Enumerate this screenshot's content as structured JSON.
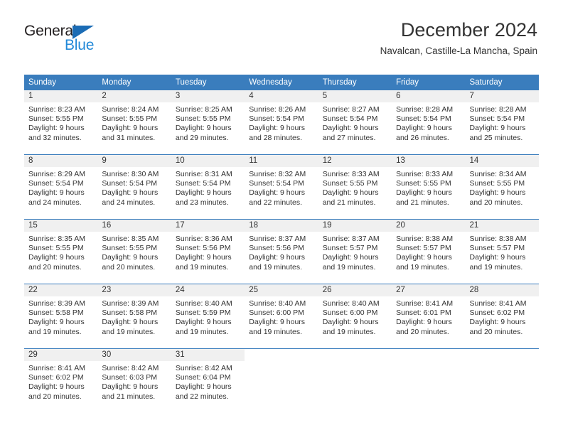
{
  "logo": {
    "text_top": "General",
    "text_bottom": "Blue",
    "triangle_color": "#1b6cb5",
    "blue_color": "#2389d8",
    "dark_color": "#231f20"
  },
  "header": {
    "title": "December 2024",
    "subtitle": "Navalcan, Castille-La Mancha, Spain"
  },
  "theme": {
    "header_row_bg": "#3a7dbd",
    "header_row_text": "#ffffff",
    "daynum_band_bg": "#f0f0f0",
    "body_text": "#333333"
  },
  "calendar": {
    "weekday_headers": [
      "Sunday",
      "Monday",
      "Tuesday",
      "Wednesday",
      "Thursday",
      "Friday",
      "Saturday"
    ],
    "weeks": [
      [
        {
          "day": "1",
          "sunrise": "Sunrise: 8:23 AM",
          "sunset": "Sunset: 5:55 PM",
          "daylight_line1": "Daylight: 9 hours",
          "daylight_line2": "and 32 minutes."
        },
        {
          "day": "2",
          "sunrise": "Sunrise: 8:24 AM",
          "sunset": "Sunset: 5:55 PM",
          "daylight_line1": "Daylight: 9 hours",
          "daylight_line2": "and 31 minutes."
        },
        {
          "day": "3",
          "sunrise": "Sunrise: 8:25 AM",
          "sunset": "Sunset: 5:55 PM",
          "daylight_line1": "Daylight: 9 hours",
          "daylight_line2": "and 29 minutes."
        },
        {
          "day": "4",
          "sunrise": "Sunrise: 8:26 AM",
          "sunset": "Sunset: 5:54 PM",
          "daylight_line1": "Daylight: 9 hours",
          "daylight_line2": "and 28 minutes."
        },
        {
          "day": "5",
          "sunrise": "Sunrise: 8:27 AM",
          "sunset": "Sunset: 5:54 PM",
          "daylight_line1": "Daylight: 9 hours",
          "daylight_line2": "and 27 minutes."
        },
        {
          "day": "6",
          "sunrise": "Sunrise: 8:28 AM",
          "sunset": "Sunset: 5:54 PM",
          "daylight_line1": "Daylight: 9 hours",
          "daylight_line2": "and 26 minutes."
        },
        {
          "day": "7",
          "sunrise": "Sunrise: 8:28 AM",
          "sunset": "Sunset: 5:54 PM",
          "daylight_line1": "Daylight: 9 hours",
          "daylight_line2": "and 25 minutes."
        }
      ],
      [
        {
          "day": "8",
          "sunrise": "Sunrise: 8:29 AM",
          "sunset": "Sunset: 5:54 PM",
          "daylight_line1": "Daylight: 9 hours",
          "daylight_line2": "and 24 minutes."
        },
        {
          "day": "9",
          "sunrise": "Sunrise: 8:30 AM",
          "sunset": "Sunset: 5:54 PM",
          "daylight_line1": "Daylight: 9 hours",
          "daylight_line2": "and 24 minutes."
        },
        {
          "day": "10",
          "sunrise": "Sunrise: 8:31 AM",
          "sunset": "Sunset: 5:54 PM",
          "daylight_line1": "Daylight: 9 hours",
          "daylight_line2": "and 23 minutes."
        },
        {
          "day": "11",
          "sunrise": "Sunrise: 8:32 AM",
          "sunset": "Sunset: 5:54 PM",
          "daylight_line1": "Daylight: 9 hours",
          "daylight_line2": "and 22 minutes."
        },
        {
          "day": "12",
          "sunrise": "Sunrise: 8:33 AM",
          "sunset": "Sunset: 5:55 PM",
          "daylight_line1": "Daylight: 9 hours",
          "daylight_line2": "and 21 minutes."
        },
        {
          "day": "13",
          "sunrise": "Sunrise: 8:33 AM",
          "sunset": "Sunset: 5:55 PM",
          "daylight_line1": "Daylight: 9 hours",
          "daylight_line2": "and 21 minutes."
        },
        {
          "day": "14",
          "sunrise": "Sunrise: 8:34 AM",
          "sunset": "Sunset: 5:55 PM",
          "daylight_line1": "Daylight: 9 hours",
          "daylight_line2": "and 20 minutes."
        }
      ],
      [
        {
          "day": "15",
          "sunrise": "Sunrise: 8:35 AM",
          "sunset": "Sunset: 5:55 PM",
          "daylight_line1": "Daylight: 9 hours",
          "daylight_line2": "and 20 minutes."
        },
        {
          "day": "16",
          "sunrise": "Sunrise: 8:35 AM",
          "sunset": "Sunset: 5:55 PM",
          "daylight_line1": "Daylight: 9 hours",
          "daylight_line2": "and 20 minutes."
        },
        {
          "day": "17",
          "sunrise": "Sunrise: 8:36 AM",
          "sunset": "Sunset: 5:56 PM",
          "daylight_line1": "Daylight: 9 hours",
          "daylight_line2": "and 19 minutes."
        },
        {
          "day": "18",
          "sunrise": "Sunrise: 8:37 AM",
          "sunset": "Sunset: 5:56 PM",
          "daylight_line1": "Daylight: 9 hours",
          "daylight_line2": "and 19 minutes."
        },
        {
          "day": "19",
          "sunrise": "Sunrise: 8:37 AM",
          "sunset": "Sunset: 5:57 PM",
          "daylight_line1": "Daylight: 9 hours",
          "daylight_line2": "and 19 minutes."
        },
        {
          "day": "20",
          "sunrise": "Sunrise: 8:38 AM",
          "sunset": "Sunset: 5:57 PM",
          "daylight_line1": "Daylight: 9 hours",
          "daylight_line2": "and 19 minutes."
        },
        {
          "day": "21",
          "sunrise": "Sunrise: 8:38 AM",
          "sunset": "Sunset: 5:57 PM",
          "daylight_line1": "Daylight: 9 hours",
          "daylight_line2": "and 19 minutes."
        }
      ],
      [
        {
          "day": "22",
          "sunrise": "Sunrise: 8:39 AM",
          "sunset": "Sunset: 5:58 PM",
          "daylight_line1": "Daylight: 9 hours",
          "daylight_line2": "and 19 minutes."
        },
        {
          "day": "23",
          "sunrise": "Sunrise: 8:39 AM",
          "sunset": "Sunset: 5:58 PM",
          "daylight_line1": "Daylight: 9 hours",
          "daylight_line2": "and 19 minutes."
        },
        {
          "day": "24",
          "sunrise": "Sunrise: 8:40 AM",
          "sunset": "Sunset: 5:59 PM",
          "daylight_line1": "Daylight: 9 hours",
          "daylight_line2": "and 19 minutes."
        },
        {
          "day": "25",
          "sunrise": "Sunrise: 8:40 AM",
          "sunset": "Sunset: 6:00 PM",
          "daylight_line1": "Daylight: 9 hours",
          "daylight_line2": "and 19 minutes."
        },
        {
          "day": "26",
          "sunrise": "Sunrise: 8:40 AM",
          "sunset": "Sunset: 6:00 PM",
          "daylight_line1": "Daylight: 9 hours",
          "daylight_line2": "and 19 minutes."
        },
        {
          "day": "27",
          "sunrise": "Sunrise: 8:41 AM",
          "sunset": "Sunset: 6:01 PM",
          "daylight_line1": "Daylight: 9 hours",
          "daylight_line2": "and 20 minutes."
        },
        {
          "day": "28",
          "sunrise": "Sunrise: 8:41 AM",
          "sunset": "Sunset: 6:02 PM",
          "daylight_line1": "Daylight: 9 hours",
          "daylight_line2": "and 20 minutes."
        }
      ],
      [
        {
          "day": "29",
          "sunrise": "Sunrise: 8:41 AM",
          "sunset": "Sunset: 6:02 PM",
          "daylight_line1": "Daylight: 9 hours",
          "daylight_line2": "and 20 minutes."
        },
        {
          "day": "30",
          "sunrise": "Sunrise: 8:42 AM",
          "sunset": "Sunset: 6:03 PM",
          "daylight_line1": "Daylight: 9 hours",
          "daylight_line2": "and 21 minutes."
        },
        {
          "day": "31",
          "sunrise": "Sunrise: 8:42 AM",
          "sunset": "Sunset: 6:04 PM",
          "daylight_line1": "Daylight: 9 hours",
          "daylight_line2": "and 22 minutes."
        },
        {
          "day": "",
          "sunrise": "",
          "sunset": "",
          "daylight_line1": "",
          "daylight_line2": ""
        },
        {
          "day": "",
          "sunrise": "",
          "sunset": "",
          "daylight_line1": "",
          "daylight_line2": ""
        },
        {
          "day": "",
          "sunrise": "",
          "sunset": "",
          "daylight_line1": "",
          "daylight_line2": ""
        },
        {
          "day": "",
          "sunrise": "",
          "sunset": "",
          "daylight_line1": "",
          "daylight_line2": ""
        }
      ]
    ]
  }
}
